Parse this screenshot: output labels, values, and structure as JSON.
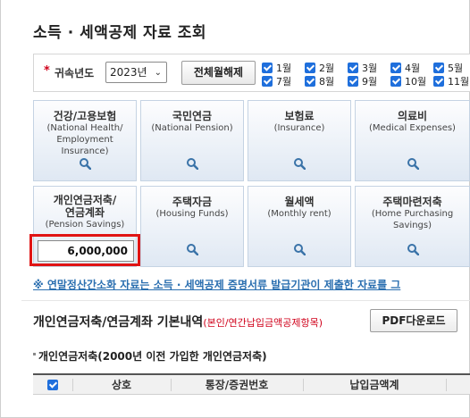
{
  "page": {
    "title": "소득 · 세액공제 자료 조회"
  },
  "filter": {
    "required_mark": "*",
    "year_label": "귀속년도",
    "year_value": "2023년",
    "toggle_button": "전체월해제",
    "months": [
      {
        "label": "1월",
        "checked": true
      },
      {
        "label": "2월",
        "checked": true
      },
      {
        "label": "3월",
        "checked": true
      },
      {
        "label": "4월",
        "checked": true
      },
      {
        "label": "5월",
        "checked": true
      },
      {
        "label": "7월",
        "checked": true
      },
      {
        "label": "8월",
        "checked": true
      },
      {
        "label": "9월",
        "checked": true
      },
      {
        "label": "10월",
        "checked": true
      },
      {
        "label": "11월",
        "checked": true
      }
    ]
  },
  "cards": [
    {
      "kr": "건강/고용보험",
      "en1": "(National Health/",
      "en2": "Employment Insurance)"
    },
    {
      "kr": "국민연금",
      "en1": "(National Pension)",
      "en2": ""
    },
    {
      "kr": "보험료",
      "en1": "(Insurance)",
      "en2": ""
    },
    {
      "kr": "의료비",
      "en1": "(Medical Expenses)",
      "en2": ""
    },
    {
      "kr": "개인연금저축/",
      "kr2": "연금계좌",
      "en1": "(Pension Savings)",
      "amount": "6,000,000"
    },
    {
      "kr": "주택자금",
      "en1": "(Housing Funds)",
      "en2": ""
    },
    {
      "kr": "월세액",
      "en1": "(Monthly rent)",
      "en2": ""
    },
    {
      "kr": "주택마련저축",
      "en1": "(Home Purchasing",
      "en2": "Savings)"
    }
  ],
  "notice": "※ 연말정산간소화 자료는 소득 · 세액공제 증명서류 발급기관이 제출한 자료를 그",
  "section": {
    "title": "개인연금저축/연금계좌 기본내역",
    "subtitle": "(본인/연간납입금액공제항목)",
    "pdf_button": "PDF다운로드",
    "subsection": "개인연금저축(2000년 이전 가입한 개인연금저축)",
    "columns": [
      "상호",
      "통장/증권번호",
      "납입금액계"
    ]
  },
  "colors": {
    "accent": "#1f6fdc",
    "notice": "#2b6fb0",
    "highlight": "#e01414",
    "required": "#d0021b"
  }
}
